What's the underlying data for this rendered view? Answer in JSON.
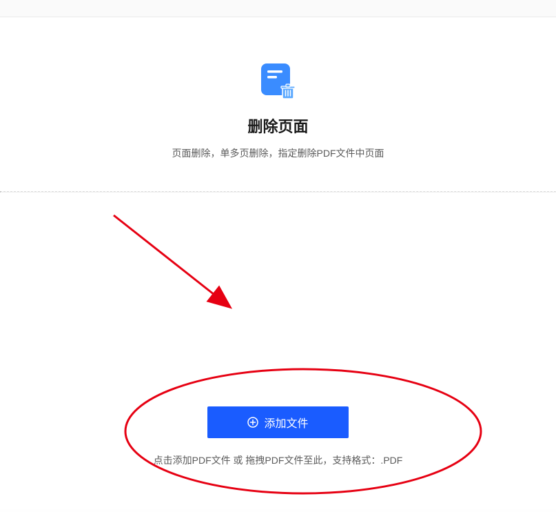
{
  "header": {
    "title": "删除页面",
    "subtitle": "页面删除，单多页删除，指定删除PDF文件中页面"
  },
  "dropZone": {
    "buttonLabel": "添加文件",
    "instruction": "点击添加PDF文件 或 拖拽PDF文件至此，支持格式：.PDF"
  },
  "icons": {
    "mainIcon": "document-delete-icon",
    "buttonIcon": "plus-circle-icon"
  },
  "colors": {
    "primary": "#1a5cff",
    "iconBlue": "#3a8cff",
    "annotation": "#e60012"
  }
}
